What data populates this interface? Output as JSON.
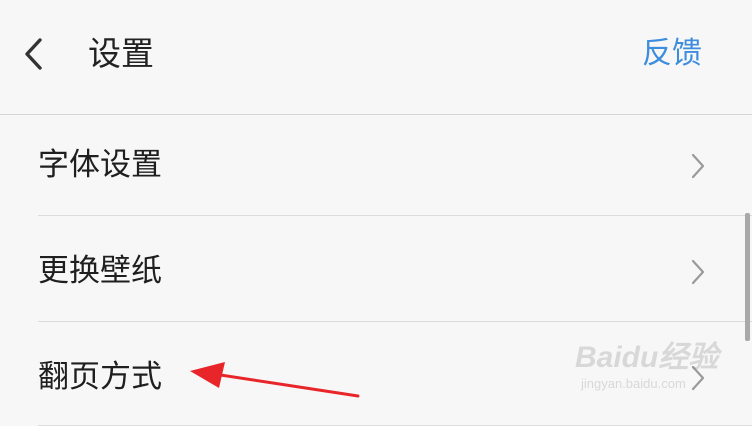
{
  "header": {
    "back_icon": "chevron-left-icon",
    "title": "设置",
    "feedback_label": "反馈"
  },
  "settings": {
    "items": [
      {
        "label": "字体设置",
        "icon": "chevron-right-icon"
      },
      {
        "label": "更换壁纸",
        "icon": "chevron-right-icon"
      },
      {
        "label": "翻页方式",
        "icon": "chevron-right-icon"
      }
    ]
  },
  "watermark": {
    "brand": "Baidu经验",
    "url": "jingyan.baidu.com"
  },
  "colors": {
    "accent": "#3d8ddf",
    "annotation_arrow": "#e8262a"
  }
}
